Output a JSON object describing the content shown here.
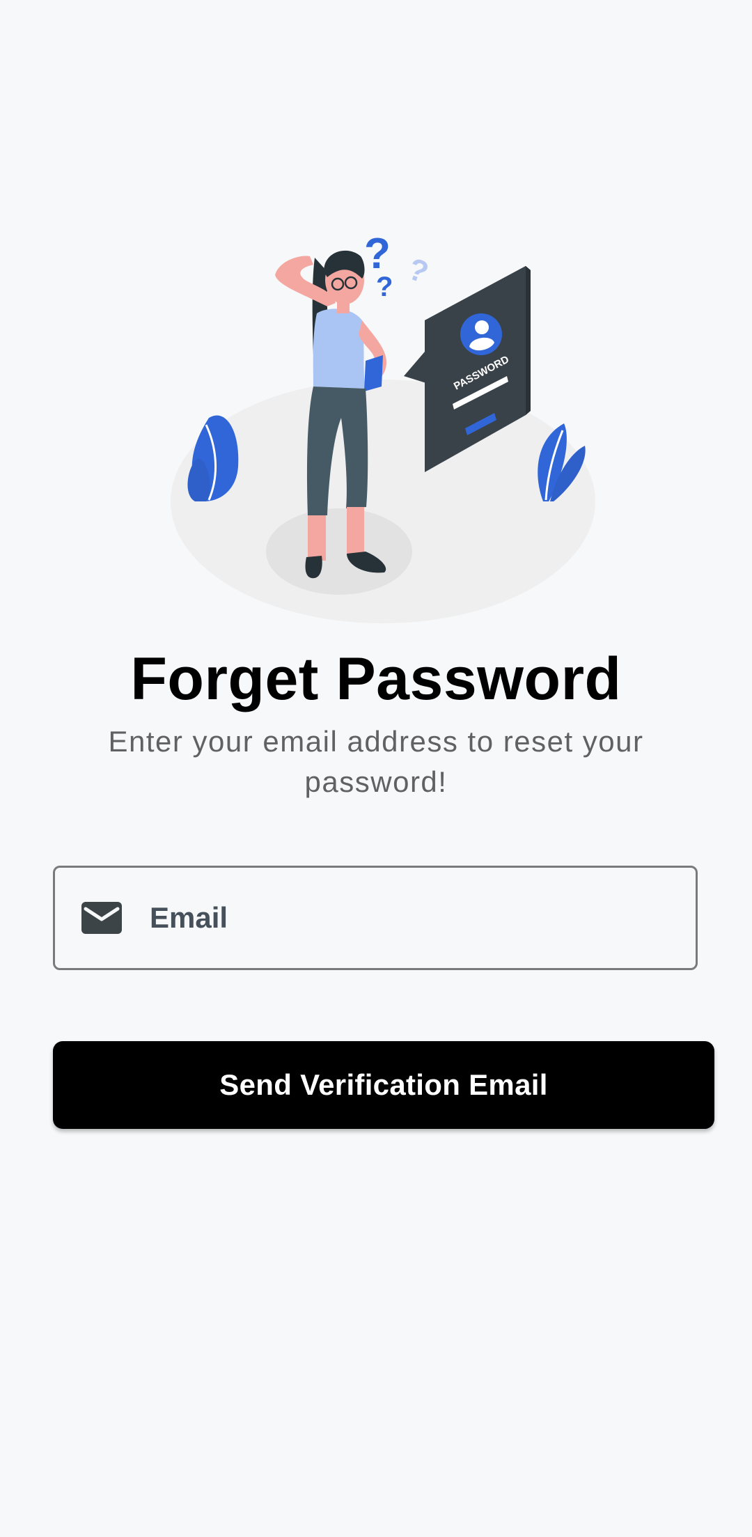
{
  "page": {
    "title": "Forget Password",
    "subtitle": "Enter your email address to reset your password!"
  },
  "illustration": {
    "card_label": "PASSWORD",
    "question_mark": "?"
  },
  "email_field": {
    "placeholder": "Email",
    "icon": "mail-icon"
  },
  "send_button": {
    "label": "Send Verification Email"
  },
  "colors": {
    "background": "#f6f8f9",
    "accent": "#3066d8",
    "button_bg": "#000000",
    "button_text": "#ffffff",
    "title": "#000000",
    "subtitle": "#616161"
  }
}
